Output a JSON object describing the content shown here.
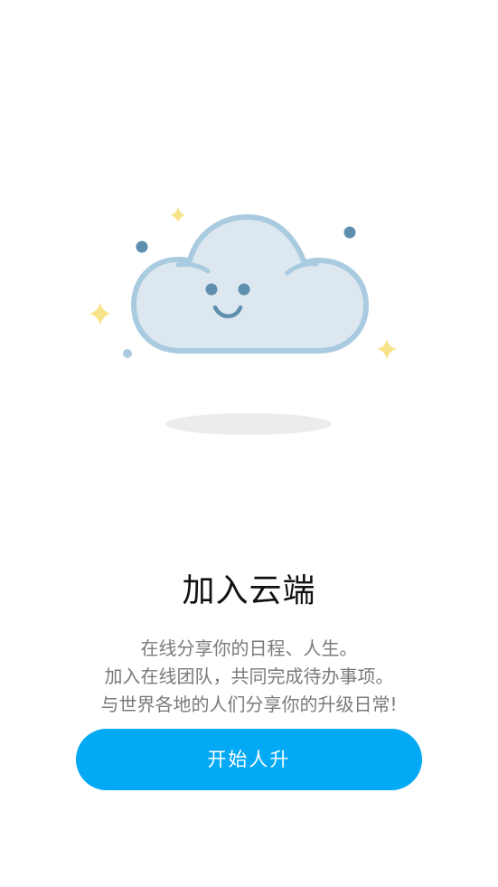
{
  "hero": {
    "title": "加入云端",
    "description_lines": [
      "在线分享你的日程、人生。",
      "加入在线团队，共同完成待办事项。",
      "与世界各地的人们分享你的升级日常!"
    ]
  },
  "cta": {
    "label": "开始人升"
  },
  "colors": {
    "accent": "#03a9f4",
    "cloud_fill": "#dce7ef",
    "cloud_stroke": "#a9cbe0",
    "dot": "#5f8fae",
    "sparkle": "#f7e48a",
    "shadow": "#ececec"
  }
}
